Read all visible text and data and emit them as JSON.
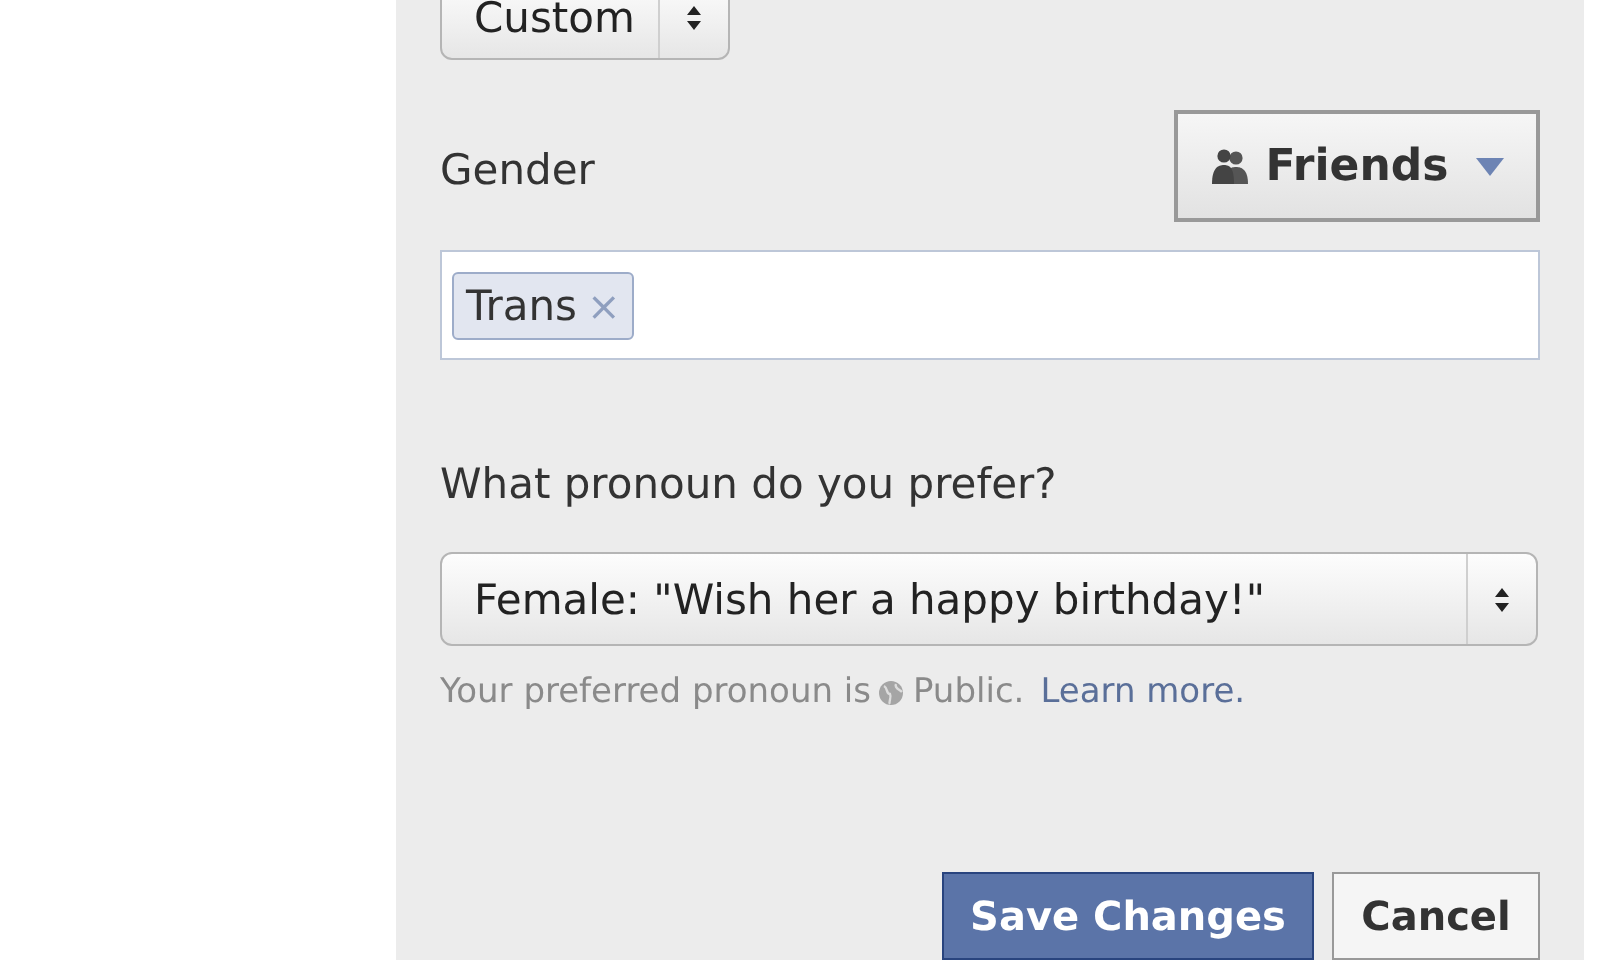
{
  "top_select": {
    "value": "Custom"
  },
  "gender": {
    "label": "Gender",
    "audience": "Friends",
    "tags": [
      {
        "text": "Trans",
        "remove": "×"
      }
    ]
  },
  "pronoun": {
    "question": "What pronoun do you prefer?",
    "value": "Female: \"Wish her a happy birthday!\"",
    "note": "Your preferred pronoun is",
    "audience": "Public.",
    "link": "Learn more."
  },
  "buttons": [
    {
      "label": "Save Changes",
      "kind": "primary"
    },
    {
      "label": "Cancel",
      "kind": "secondary"
    }
  ]
}
